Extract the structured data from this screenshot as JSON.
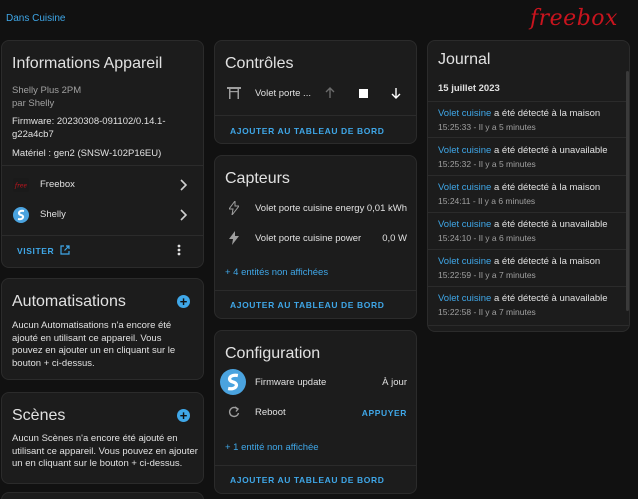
{
  "breadcrumb": "Dans Cuisine",
  "brand": "freebox",
  "device_info": {
    "title": "Informations Appareil",
    "model": "Shelly Plus 2PM",
    "manufacturer": "par Shelly",
    "firmware": "Firmware: 20230308-091102/0.14.1-g22a4cb7",
    "hardware": "Matériel : gen2 (SNSW-102P16EU)",
    "integrations": [
      {
        "label": "Freebox"
      },
      {
        "label": "Shelly"
      }
    ],
    "visit_label": "VISITER"
  },
  "automations": {
    "title": "Automatisations",
    "body": "Aucun Automatisations n'a encore été ajouté en utilisant ce appareil. Vous pouvez en ajouter un en cliquant sur le bouton + ci-dessus."
  },
  "scenes": {
    "title": "Scènes",
    "body": "Aucun Scènes n'a encore été ajouté en utilisant ce appareil. Vous pouvez en ajouter un en cliquant sur le bouton + ci-dessus."
  },
  "controls": {
    "title": "Contrôles",
    "entity": "Volet porte ...",
    "add_label": "AJOUTER AU TABLEAU DE BORD"
  },
  "sensors": {
    "title": "Capteurs",
    "rows": [
      {
        "name": "Volet porte cuisine energy",
        "value": "0,01 kWh"
      },
      {
        "name": "Volet porte cuisine power",
        "value": "0,0 W"
      }
    ],
    "hidden": "+ 4 entités non affichées",
    "add_label": "AJOUTER AU TABLEAU DE BORD"
  },
  "configuration": {
    "title": "Configuration",
    "firmware_label": "Firmware update",
    "firmware_state": "À jour",
    "reboot_label": "Reboot",
    "press_label": "APPUYER",
    "hidden": "+ 1 entité non affichée",
    "add_label": "AJOUTER AU TABLEAU DE BORD"
  },
  "journal": {
    "title": "Journal",
    "date": "15 juillet 2023",
    "entries": [
      {
        "entity": "Volet cuisine",
        "message": " a été détecté à la maison",
        "time": "15:25:33 - Il y a 5 minutes"
      },
      {
        "entity": "Volet cuisine",
        "message": " a été détecté à unavailable",
        "time": "15:25:32 - Il y a 5 minutes"
      },
      {
        "entity": "Volet cuisine",
        "message": " a été détecté à la maison",
        "time": "15:24:11 - Il y a 6 minutes"
      },
      {
        "entity": "Volet cuisine",
        "message": " a été détecté à unavailable",
        "time": "15:24:10 - Il y a 6 minutes"
      },
      {
        "entity": "Volet cuisine",
        "message": " a été détecté à la maison",
        "time": "15:22:59 - Il y a 7 minutes"
      },
      {
        "entity": "Volet cuisine",
        "message": " a été détecté à unavailable",
        "time": "15:22:58 - Il y a 7 minutes"
      }
    ]
  },
  "colors": {
    "accent": "#3fa7e8",
    "brand": "#c9141e",
    "background": "#111111",
    "card": "#1c1c1c"
  }
}
